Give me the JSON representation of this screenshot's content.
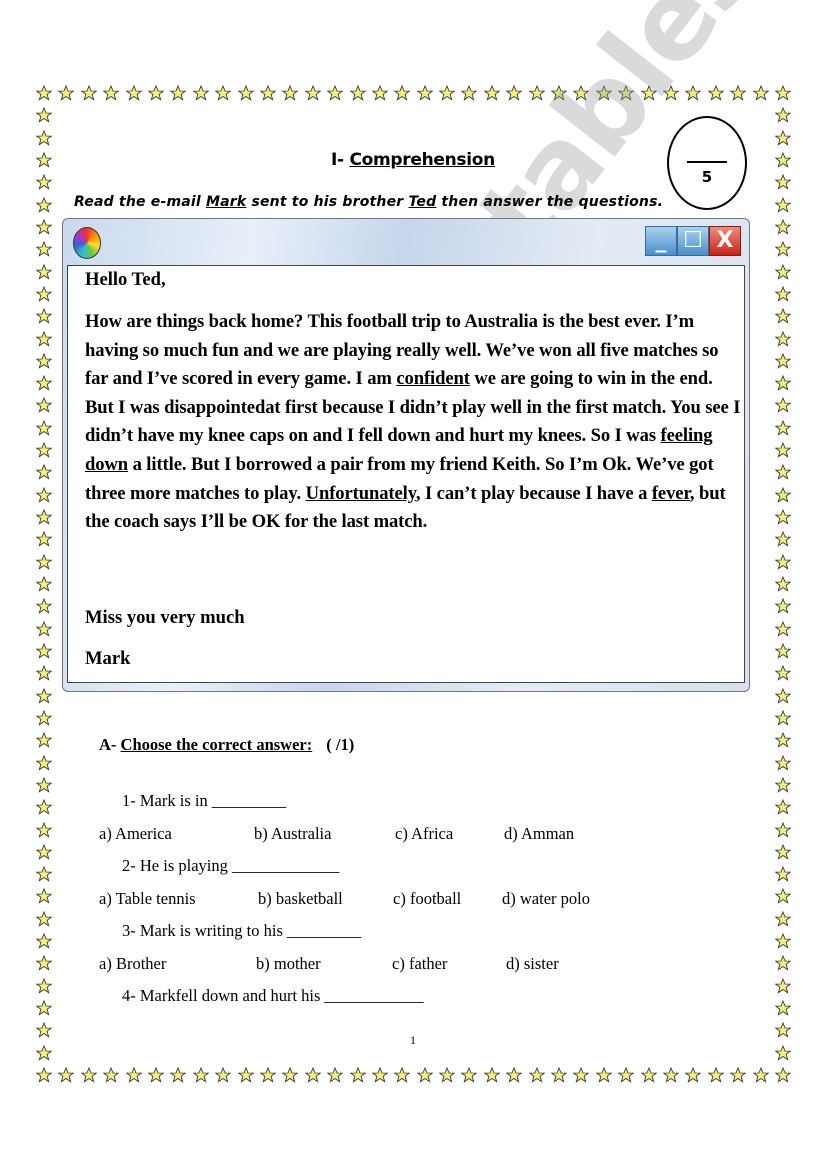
{
  "title": {
    "prefix": "I- ",
    "text": "Comprehension"
  },
  "score": {
    "denominator": "5"
  },
  "instruction": [
    {
      "t": "Read the e-mail ",
      "u": false
    },
    {
      "t": "Mark",
      "u": true
    },
    {
      "t": " sent to his brother ",
      "u": false
    },
    {
      "t": "Ted",
      "u": true
    },
    {
      "t": " then answer the questions.",
      "u": false
    }
  ],
  "window": {
    "min": "_",
    "max": "☐",
    "close": "X"
  },
  "email": {
    "greeting": "Hello Ted,",
    "paragraph": [
      {
        "t": "How are things back home? This football trip to Australia is the best ever. I’m having so much fun and we are playing really well. We’ve won all five matches so far and I’ve scored in every game. I am ",
        "u": false
      },
      {
        "t": "confident",
        "u": true
      },
      {
        "t": " we are going to win in the end. But I was disappointedat first because I didn’t play well in the first match. You see I didn’t have my knee caps on and I fell down and hurt my knees. So I was ",
        "u": false
      },
      {
        "t": "feeling down",
        "u": true
      },
      {
        "t": " a little. But I borrowed a pair from my friend Keith. So I’m Ok. We’ve got three more matches to play. ",
        "u": false
      },
      {
        "t": "Unfortunately",
        "u": true
      },
      {
        "t": ", I can’t play because I have a ",
        "u": false
      },
      {
        "t": "fever",
        "u": true
      },
      {
        "t": ", but the coach says I’ll be OK for the last match.",
        "u": false
      }
    ],
    "closing": "Miss you very much",
    "signature": "Mark"
  },
  "watermark": "ESLprintables.com",
  "section_a": {
    "prefix": "A- ",
    "title": "Choose the correct answer:",
    "score": "(          /1)"
  },
  "questions": [
    {
      "q": "1-  Mark is in _________",
      "options": [
        "a)  America",
        "b) Australia",
        "c) Africa",
        "d) Amman"
      ]
    },
    {
      "q": "2-  He is playing _____________",
      "options": [
        "a)  Table tennis",
        "b) basketball",
        "c) football",
        "d) water polo"
      ]
    },
    {
      "q": "3-  Mark is writing to his _________",
      "options": [
        "a)  Brother",
        "b) mother",
        "c) father",
        "d) sister"
      ]
    },
    {
      "q": "4-  Markfell down and hurt his ____________",
      "options": []
    }
  ],
  "page_number": "1",
  "colors": {
    "star": "#f5f07a",
    "star_outline": "#333333",
    "close_button": "#d0281e",
    "window_button": "#5a9ad2"
  }
}
